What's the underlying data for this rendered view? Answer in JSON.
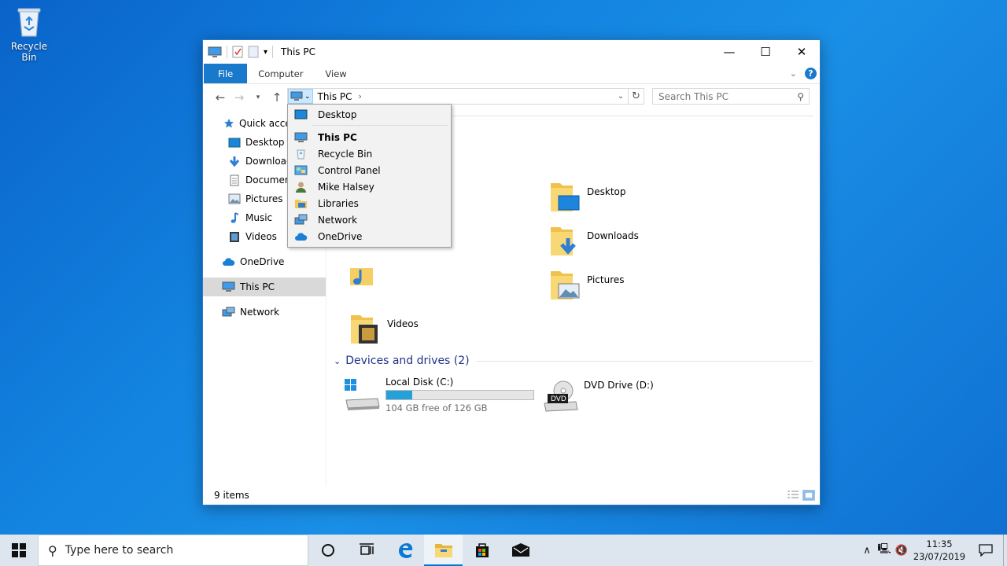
{
  "desktop": {
    "recycle_bin_label": "Recycle Bin"
  },
  "window": {
    "title": "This PC",
    "controls": {
      "minimize": "—",
      "maximize": "☐",
      "close": "✕"
    }
  },
  "ribbon": {
    "tabs": [
      {
        "label": "File"
      },
      {
        "label": "Computer"
      },
      {
        "label": "View"
      }
    ],
    "help": "?"
  },
  "address": {
    "path": "This PC",
    "separator": "›",
    "search_placeholder": "Search This PC"
  },
  "sidebar": {
    "items": [
      {
        "label": "Quick access",
        "icon": "star-icon"
      },
      {
        "label": "Desktop",
        "icon": "desktop-icon"
      },
      {
        "label": "Downloads",
        "icon": "download-icon"
      },
      {
        "label": "Documents",
        "icon": "document-icon"
      },
      {
        "label": "Pictures",
        "icon": "picture-icon"
      },
      {
        "label": "Music",
        "icon": "music-icon"
      },
      {
        "label": "Videos",
        "icon": "video-icon"
      },
      {
        "label": "OneDrive",
        "icon": "cloud-icon"
      },
      {
        "label": "This PC",
        "icon": "computer-icon",
        "selected": true
      },
      {
        "label": "Network",
        "icon": "network-icon"
      }
    ]
  },
  "main": {
    "folders": [
      {
        "label": "Desktop"
      },
      {
        "label": "Downloads"
      },
      {
        "label": "Pictures"
      },
      {
        "label": "Videos"
      }
    ],
    "devices_header": "Devices and drives (2)",
    "drives": [
      {
        "name": "Local Disk (C:)",
        "free_text": "104 GB free of 126 GB",
        "used_fraction": 0.175
      },
      {
        "name": "DVD Drive (D:)",
        "badge": "DVD"
      }
    ]
  },
  "status": {
    "items_count": "9 items"
  },
  "dropdown": {
    "items": [
      {
        "label": "Desktop",
        "icon": "desktop-icon"
      },
      {
        "label": "This PC",
        "icon": "computer-icon",
        "bold": true
      },
      {
        "label": "Recycle Bin",
        "icon": "recycle-bin-icon"
      },
      {
        "label": "Control Panel",
        "icon": "control-panel-icon"
      },
      {
        "label": "Mike Halsey",
        "icon": "user-icon"
      },
      {
        "label": "Libraries",
        "icon": "library-icon"
      },
      {
        "label": "Network",
        "icon": "network-icon"
      },
      {
        "label": "OneDrive",
        "icon": "cloud-icon"
      }
    ]
  },
  "taskbar": {
    "search_placeholder": "Type here to search",
    "clock_time": "11:35",
    "clock_date": "23/07/2019"
  },
  "colors": {
    "accent": "#1979ca",
    "drive_bar": "#26a0da",
    "group_header": "#1e3287"
  }
}
